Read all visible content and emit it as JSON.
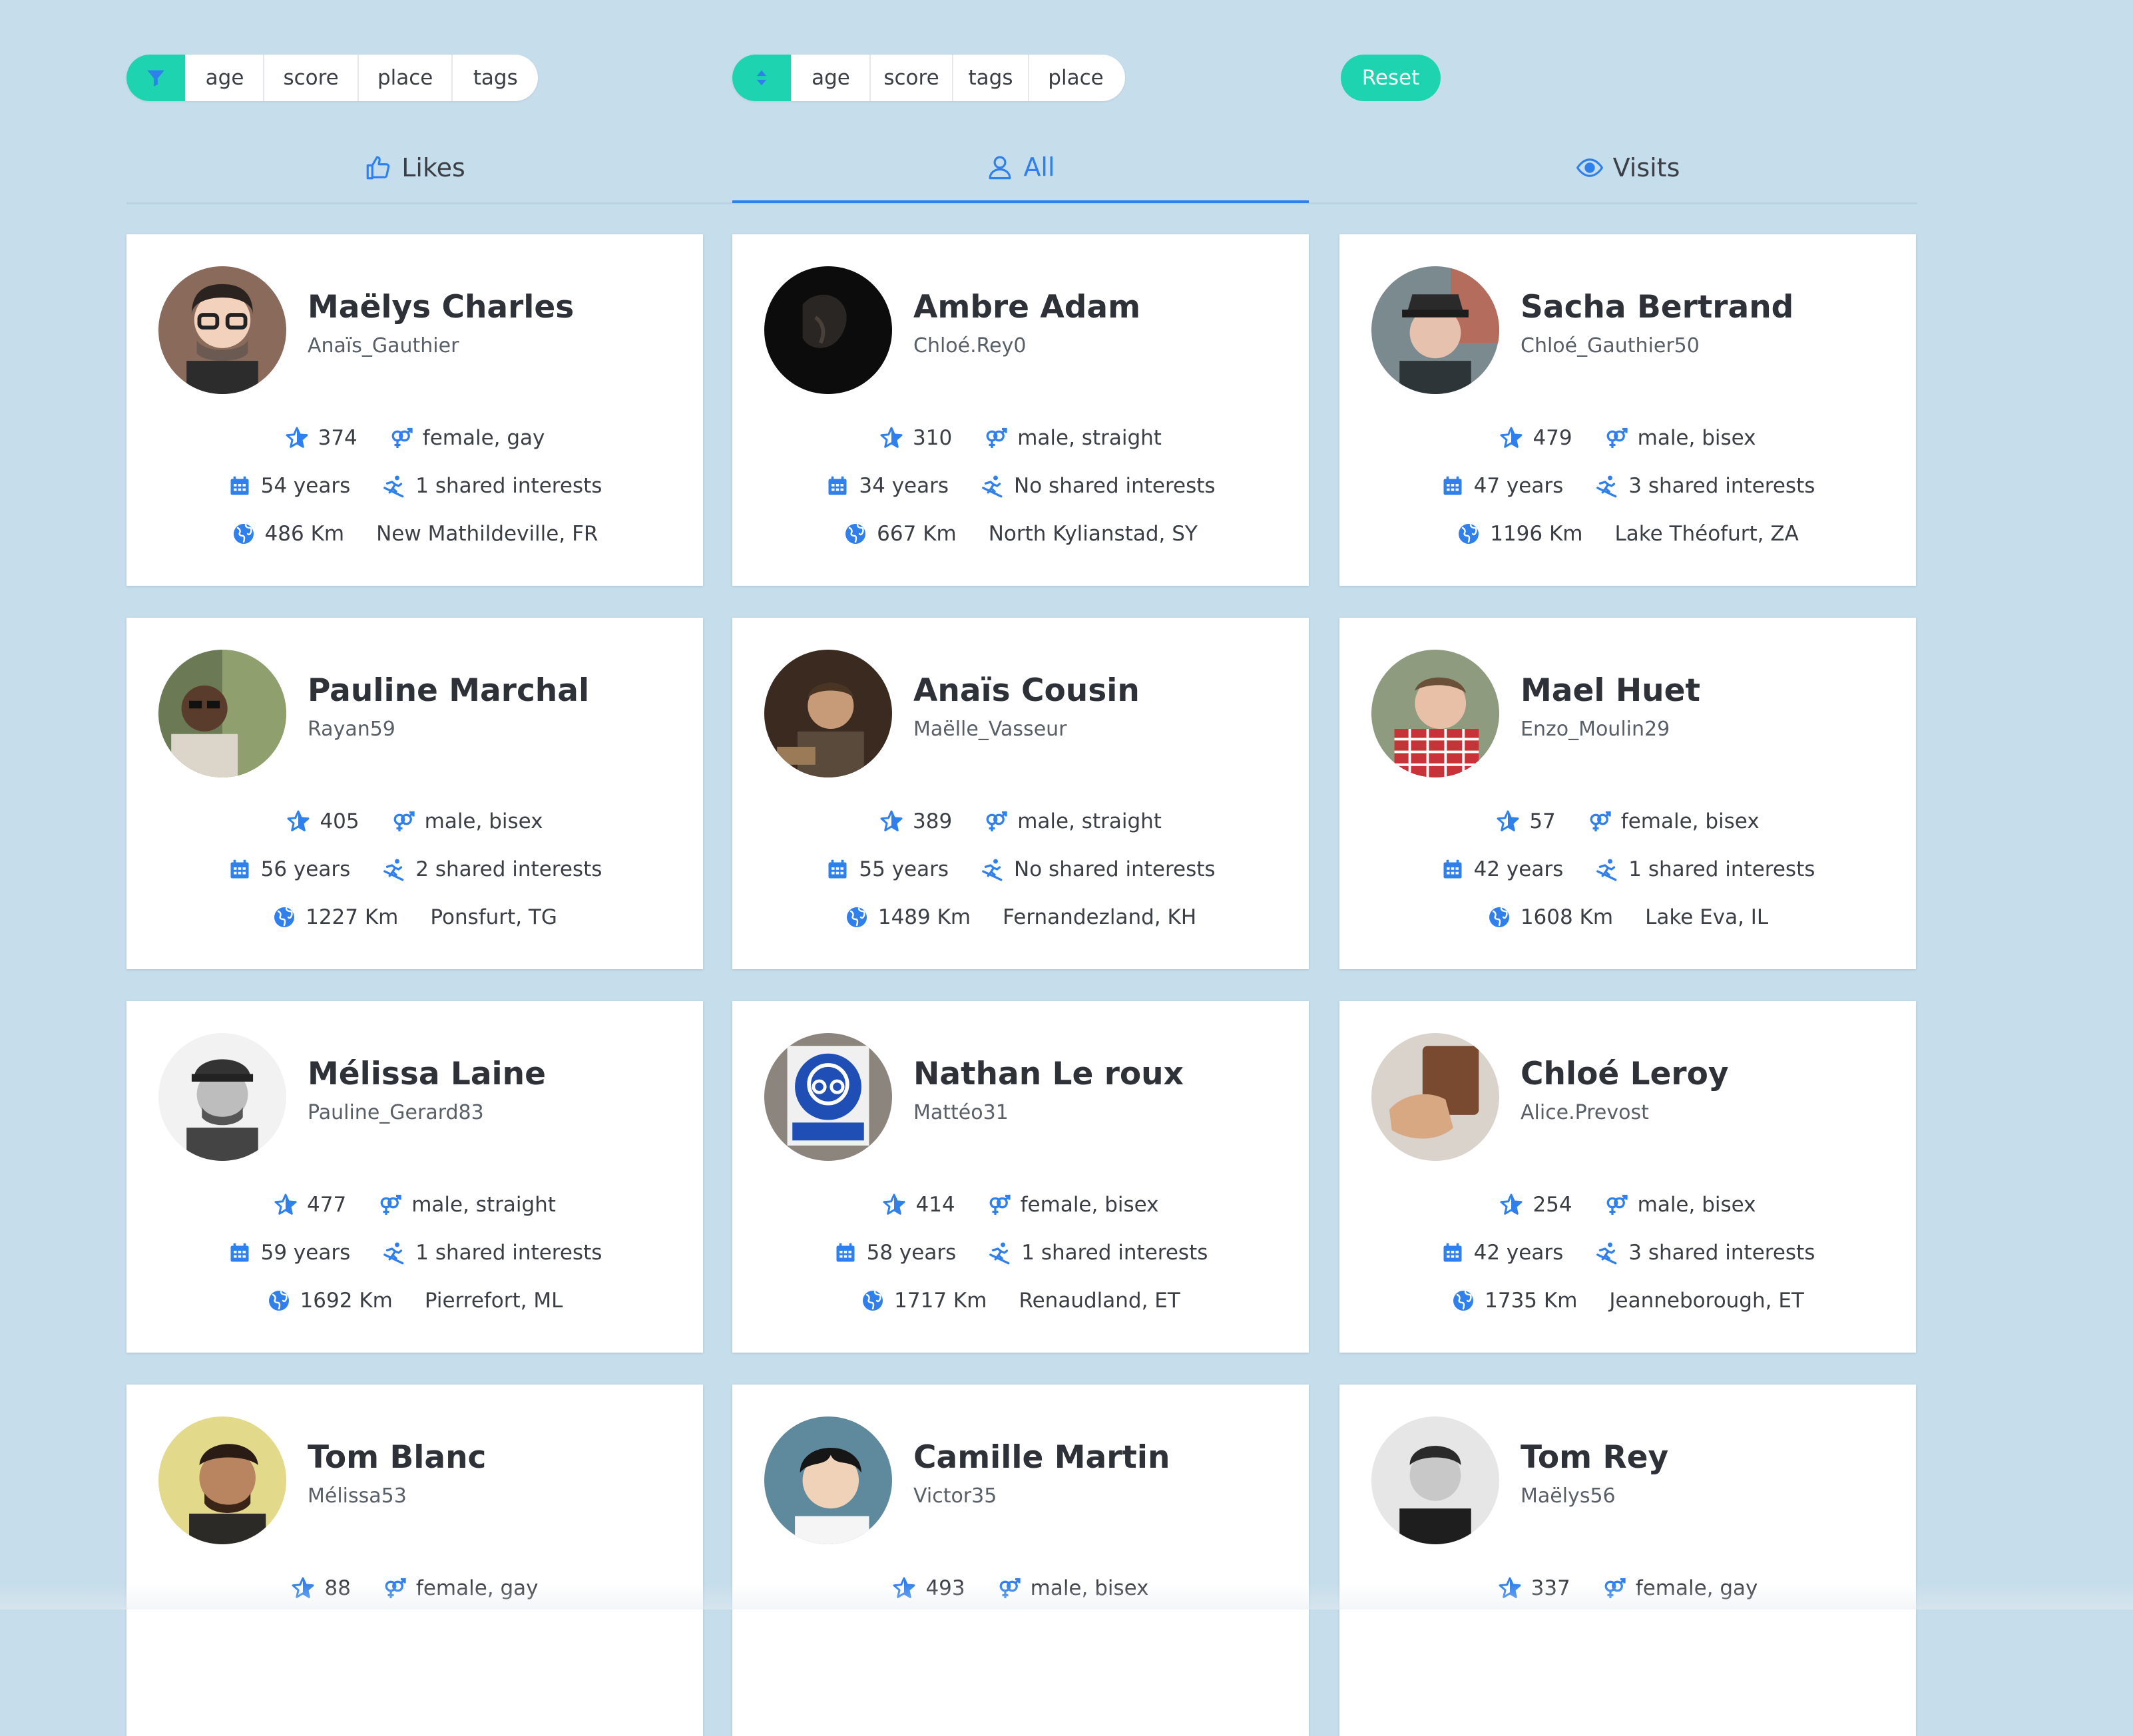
{
  "filter": {
    "icon": "filter-icon",
    "options": [
      "age",
      "score",
      "place",
      "tags"
    ]
  },
  "sort": {
    "icon": "sort-icon",
    "options": [
      "age",
      "score",
      "tags",
      "place"
    ]
  },
  "reset_label": "Reset",
  "tabs": [
    {
      "label": "Likes",
      "icon": "thumbs-up-icon",
      "active": false
    },
    {
      "label": "All",
      "icon": "user-icon",
      "active": true
    },
    {
      "label": "Visits",
      "icon": "eye-icon",
      "active": false
    }
  ],
  "colors": {
    "accent": "#1dd3b0",
    "primary_blue": "#2f80ed",
    "background": "#c6ddeb"
  },
  "profiles": [
    {
      "name": "Maëlys Charles",
      "username": "Anaïs_Gauthier",
      "score": "374",
      "orientation": "female, gay",
      "age": "54 years",
      "interests": "1 shared interests",
      "distance": "486 Km",
      "location": "New Mathildeville, FR"
    },
    {
      "name": "Ambre Adam",
      "username": "Chloé.Rey0",
      "score": "310",
      "orientation": "male, straight",
      "age": "34 years",
      "interests": "No shared interests",
      "distance": "667 Km",
      "location": "North Kylianstad, SY"
    },
    {
      "name": "Sacha Bertrand",
      "username": "Chloé_Gauthier50",
      "score": "479",
      "orientation": "male, bisex",
      "age": "47 years",
      "interests": "3 shared interests",
      "distance": "1196 Km",
      "location": "Lake Théofurt, ZA"
    },
    {
      "name": "Pauline Marchal",
      "username": "Rayan59",
      "score": "405",
      "orientation": "male, bisex",
      "age": "56 years",
      "interests": "2 shared interests",
      "distance": "1227 Km",
      "location": "Ponsfurt, TG"
    },
    {
      "name": "Anaïs Cousin",
      "username": "Maëlle_Vasseur",
      "score": "389",
      "orientation": "male, straight",
      "age": "55 years",
      "interests": "No shared interests",
      "distance": "1489 Km",
      "location": "Fernandezland, KH"
    },
    {
      "name": "Mael Huet",
      "username": "Enzo_Moulin29",
      "score": "57",
      "orientation": "female, bisex",
      "age": "42 years",
      "interests": "1 shared interests",
      "distance": "1608 Km",
      "location": "Lake Eva, IL"
    },
    {
      "name": "Mélissa Laine",
      "username": "Pauline_Gerard83",
      "score": "477",
      "orientation": "male, straight",
      "age": "59 years",
      "interests": "1 shared interests",
      "distance": "1692 Km",
      "location": "Pierrefort, ML"
    },
    {
      "name": "Nathan Le roux",
      "username": "Mattéo31",
      "score": "414",
      "orientation": "female, bisex",
      "age": "58 years",
      "interests": "1 shared interests",
      "distance": "1717 Km",
      "location": "Renaudland, ET"
    },
    {
      "name": "Chloé Leroy",
      "username": "Alice.Prevost",
      "score": "254",
      "orientation": "male, bisex",
      "age": "42 years",
      "interests": "3 shared interests",
      "distance": "1735 Km",
      "location": "Jeanneborough, ET"
    },
    {
      "name": "Tom Blanc",
      "username": "Mélissa53",
      "score": "88",
      "orientation": "female, gay"
    },
    {
      "name": "Camille Martin",
      "username": "Victor35",
      "score": "493",
      "orientation": "male, bisex"
    },
    {
      "name": "Tom Rey",
      "username": "Maëlys56",
      "score": "337",
      "orientation": "female, gay"
    }
  ]
}
